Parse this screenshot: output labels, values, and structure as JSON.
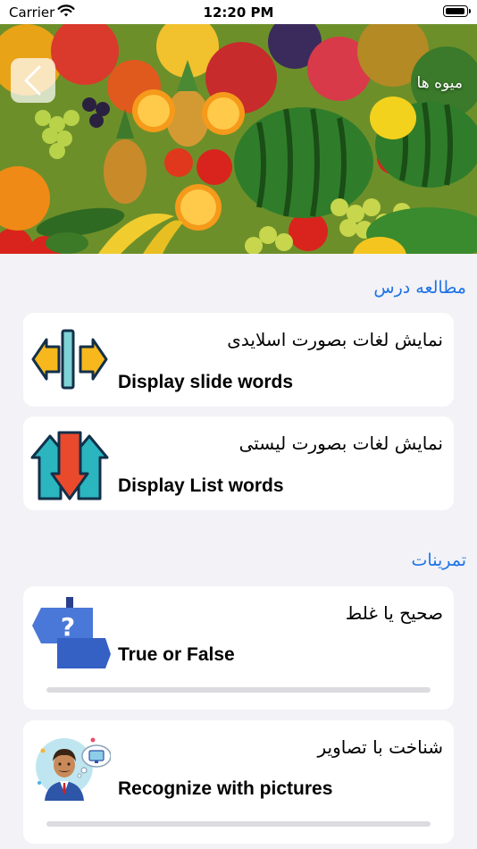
{
  "status_bar": {
    "carrier": "Carrier",
    "time": "12:20 PM",
    "battery_level": 1.0
  },
  "hero": {
    "title": "میوه ها",
    "back_icon": "chevron-left-icon"
  },
  "sections": {
    "study": {
      "header": "مطالعه درس",
      "items": [
        {
          "title_fa": "نمایش لغات بصورت اسلایدی",
          "title_en": "Display slide words",
          "icon": "slide-arrows-icon"
        },
        {
          "title_fa": "نمایش لغات بصورت لیستی",
          "title_en": "Display List words",
          "icon": "list-arrows-icon"
        }
      ]
    },
    "exercises": {
      "header": "تمرینات",
      "items": [
        {
          "title_fa": "صحیح یا غلط",
          "title_en": "True or False",
          "icon": "question-signpost-icon",
          "progress": 0
        },
        {
          "title_fa": "شناخت با تصاویر",
          "title_en": "Recognize with pictures",
          "icon": "person-thinking-icon",
          "progress": 0
        }
      ]
    }
  },
  "colors": {
    "accent": "#1e73e8",
    "background": "#f2f2f7"
  }
}
